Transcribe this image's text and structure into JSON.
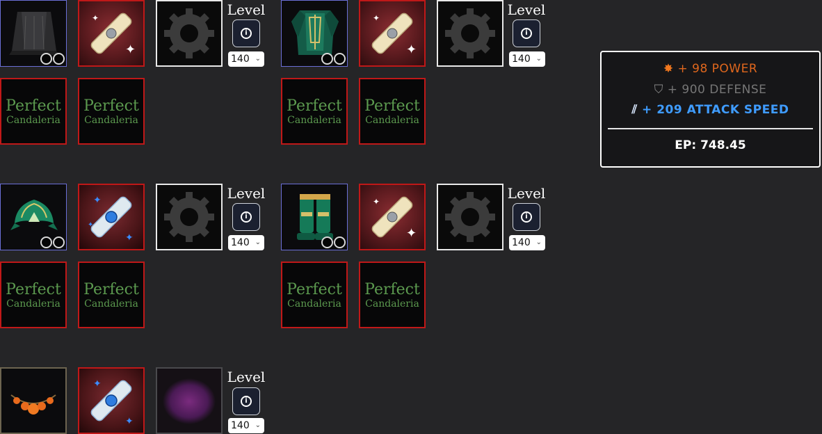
{
  "level_label": "Level",
  "level_value": "140",
  "perfect_line1": "Perfect",
  "perfect_line2": "Candaleria",
  "tooltip": {
    "power": "+ 98 POWER",
    "defense": "+ 900 DEFENSE",
    "attack_speed": "+ 209 ATTACK SPEED",
    "ep": "EP: 748.45"
  },
  "colors": {
    "power": "#e0671d",
    "defense": "#767676",
    "attack_speed": "#3f9cff",
    "perfect_text": "#5c9a4f"
  },
  "icons": [
    "cape-icon",
    "chest-armor-icon",
    "helmet-icon",
    "leg-armor-icon",
    "necklace-icon",
    "enchant-scroll-icon",
    "gear-icon",
    "purple-crystal-icon",
    "info-icon",
    "chevron-down-icon",
    "sunburst-icon",
    "shield-icon",
    "speed-icon"
  ]
}
